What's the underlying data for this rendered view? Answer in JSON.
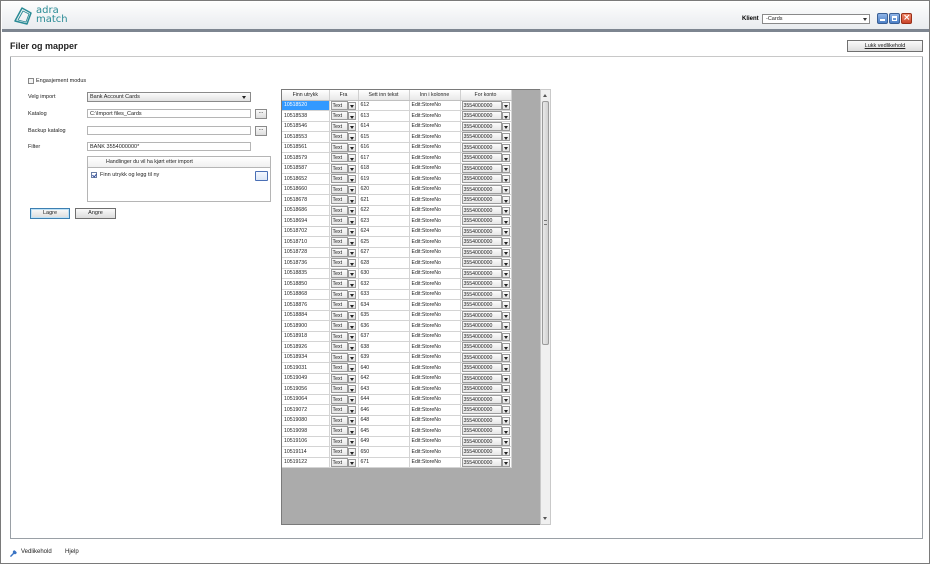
{
  "header": {
    "logo_line1": "adra",
    "logo_line2": "match",
    "klient_label": "Klient",
    "klient_value": "-Cards"
  },
  "page": {
    "title": "Filer og mapper",
    "lukk_label": "Lukk vedlikehold"
  },
  "form": {
    "engasjement_label": "Engasjement modus",
    "engasjement_checked": false,
    "velg_import_label": "Velg import",
    "velg_import_value": "Bank Account Cards",
    "katalog_label": "Katalog",
    "katalog_value": "C:\\Import files_Cards",
    "backup_label": "Backup katalog",
    "backup_value": "",
    "filter_label": "Filter",
    "filter_value": "BANK 3554000000*",
    "browse_label": "...",
    "actions_header": "Handlinger du vil ha kjørt etter import",
    "action_item": "Finn utrykk og legg til ny",
    "action_item_checked": true,
    "lagre_label": "Lagre",
    "angre_label": "Angre"
  },
  "grid": {
    "columns": [
      "Finn utrykk",
      "Fra",
      "Sett inn tekst",
      "Inn i kolonne",
      "For konto"
    ],
    "fra_value": "Text",
    "kolonne_value": "Edit:StoreNo",
    "konto_value": "3554000000",
    "rows": [
      [
        "10518520",
        "612"
      ],
      [
        "10518538",
        "613"
      ],
      [
        "10518546",
        "614"
      ],
      [
        "10518553",
        "615"
      ],
      [
        "10518561",
        "616"
      ],
      [
        "10518579",
        "617"
      ],
      [
        "10518587",
        "618"
      ],
      [
        "10518652",
        "619"
      ],
      [
        "10518660",
        "620"
      ],
      [
        "10518678",
        "621"
      ],
      [
        "10518686",
        "622"
      ],
      [
        "10518694",
        "623"
      ],
      [
        "10518702",
        "624"
      ],
      [
        "10518710",
        "625"
      ],
      [
        "10518728",
        "627"
      ],
      [
        "10518736",
        "628"
      ],
      [
        "10518835",
        "630"
      ],
      [
        "10518850",
        "632"
      ],
      [
        "10518868",
        "633"
      ],
      [
        "10518876",
        "634"
      ],
      [
        "10518884",
        "635"
      ],
      [
        "10518900",
        "636"
      ],
      [
        "10518918",
        "637"
      ],
      [
        "10518926",
        "638"
      ],
      [
        "10518934",
        "639"
      ],
      [
        "10519031",
        "640"
      ],
      [
        "10519049",
        "642"
      ],
      [
        "10519056",
        "643"
      ],
      [
        "10519064",
        "644"
      ],
      [
        "10519072",
        "646"
      ],
      [
        "10519080",
        "648"
      ],
      [
        "10519098",
        "645"
      ],
      [
        "10519106",
        "649"
      ],
      [
        "10519114",
        "650"
      ],
      [
        "10519122",
        "671"
      ]
    ]
  },
  "footer": {
    "vedlikehold_label": "Vedlikehold",
    "hjelp_label": "Hjelp"
  },
  "colors": {
    "selection": "#3399ff",
    "logo": "#2a8b95",
    "header_band": "#7d8590"
  },
  "icons": [
    "adra-match-logo",
    "minimize-icon",
    "maximize-icon",
    "close-icon",
    "wrench-icon",
    "chevron-down-icon",
    "ellipsis-icon"
  ]
}
